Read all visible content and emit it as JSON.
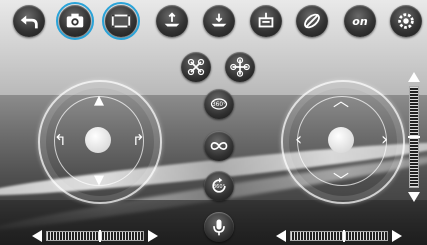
{
  "colors": {
    "selected_ring": "#2aa3d8",
    "accent": "#ffffff"
  },
  "top_bar": {
    "buttons": [
      {
        "icon": "back-arrow-icon"
      },
      {
        "icon": "camera-icon",
        "selected": true
      },
      {
        "icon": "video-icon",
        "selected": true
      },
      {
        "icon": "takeoff-icon"
      },
      {
        "icon": "landing-icon"
      },
      {
        "icon": "calibrate-icon"
      },
      {
        "icon": "gyro-icon"
      },
      {
        "icon": "on-icon",
        "label": "on"
      },
      {
        "icon": "settings-gear-icon"
      }
    ]
  },
  "center_column": {
    "buttons": [
      {
        "icon": "drone-mode-a-icon"
      },
      {
        "icon": "drone-mode-b-icon"
      },
      {
        "icon": "flip-360-icon",
        "label": "360°"
      },
      {
        "icon": "infinity-path-icon"
      },
      {
        "icon": "rotate-360-icon",
        "label": "360°"
      },
      {
        "icon": "voice-control-icon"
      }
    ]
  },
  "left_joystick": {
    "arrows": [
      "up",
      "down",
      "rotate-left",
      "rotate-right"
    ]
  },
  "right_joystick": {
    "arrows": [
      "up",
      "down",
      "left",
      "right"
    ]
  },
  "trims": {
    "left_horizontal": {
      "level": 0.55
    },
    "right_horizontal": {
      "level": 0.55
    },
    "right_vertical": {
      "level": 0.5
    }
  }
}
